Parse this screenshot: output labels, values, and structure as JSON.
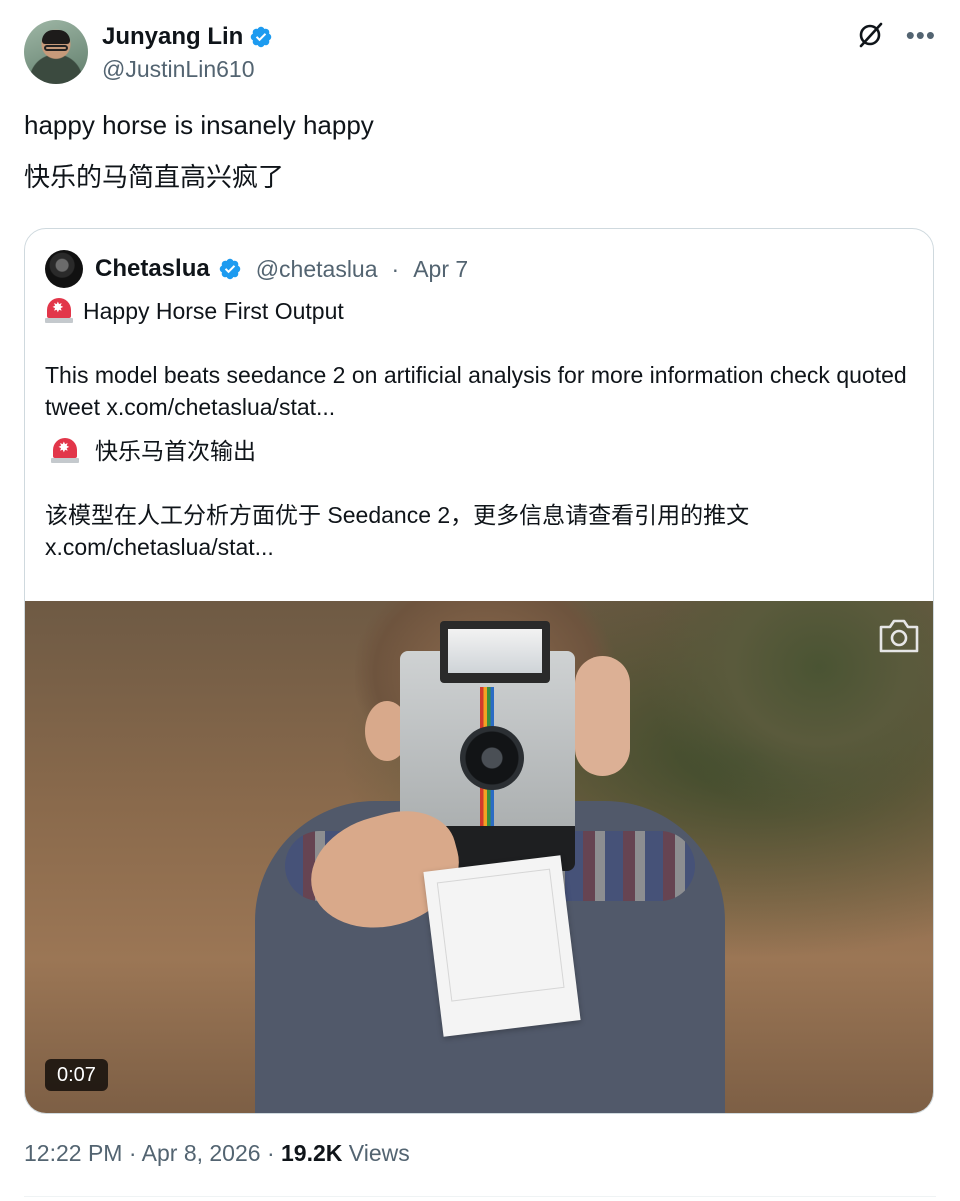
{
  "author": {
    "name": "Junyang Lin",
    "handle": "@JustinLin610"
  },
  "icons": {
    "verified": "verified-badge-icon",
    "grok": "grok-icon",
    "more": "more-icon",
    "camera": "camera-icon",
    "siren": "rotating-light-icon"
  },
  "tweet": {
    "line1": "happy horse is insanely happy",
    "line2": "快乐的马简直高兴疯了"
  },
  "quote": {
    "name": "Chetaslua",
    "handle": "@chetaslua",
    "separator": "·",
    "date": "Apr 7",
    "title_en": "Happy Horse First Output",
    "body_en": "This model beats seedance 2 on artificial analysis for more information check quoted tweet  x.com/chetaslua/stat...",
    "title_zh": "快乐马首次输出",
    "body_zh_line1": "该模型在人工分析方面优于 Seedance 2，更多信息请查看引用的推文",
    "body_zh_line2": "x.com/chetaslua/stat...",
    "video_duration": "0:07"
  },
  "footer": {
    "time": "12:22 PM",
    "date": "Apr 8, 2026",
    "separator": "·",
    "views_count": "19.2K",
    "views_label": "Views"
  },
  "colors": {
    "text": "#0f1419",
    "secondary": "#536471",
    "verified": "#1d9bf0",
    "border": "#cfd9de"
  }
}
